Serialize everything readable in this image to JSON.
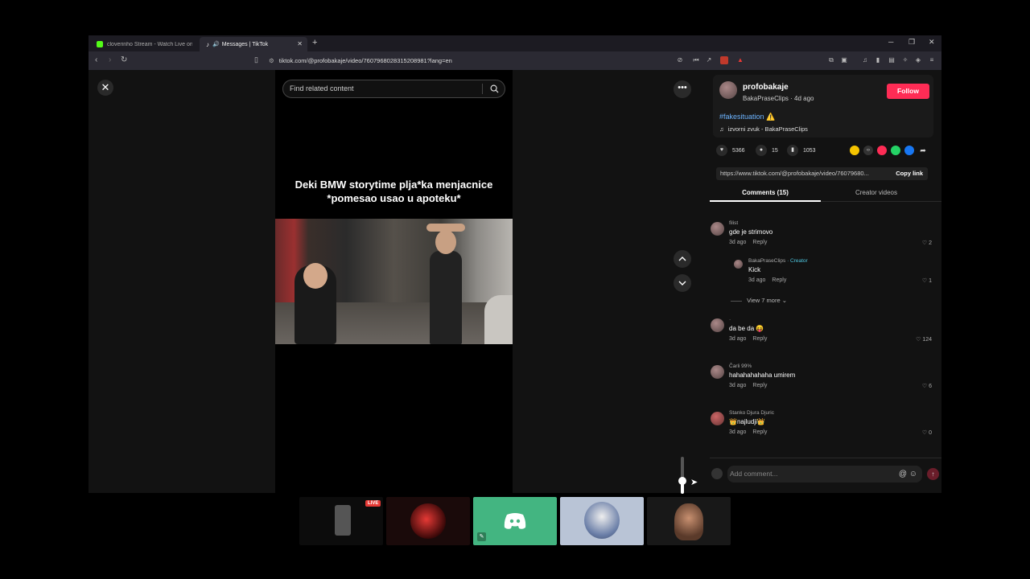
{
  "browser": {
    "tabs": [
      {
        "label": "cloverinho Stream - Watch Live on K",
        "favicon_color": "#53fc18"
      },
      {
        "label": "Messages | TikTok",
        "favicon_color": "#ffffff"
      }
    ],
    "url": "tiktok.com/@profobakaje/video/7607968028315208981?lang=en"
  },
  "video": {
    "search_placeholder": "Find related content",
    "caption_line1": "Deki BMW storytime plja*ka menjacnice",
    "caption_line2": "*pomesao usao u apoteku*",
    "volume_level": 0.35
  },
  "post": {
    "username": "profobakaje",
    "subline": "BakaPraseClips · 4d ago",
    "follow_label": "Follow",
    "hashtag": "#fakesituation ⚠️",
    "music": "izvorni zvuk - BakaPraseClips",
    "likes": "5366",
    "comments": "15",
    "saves": "1053",
    "link": "https://www.tiktok.com/@profobakaje/video/76079680...",
    "copy_label": "Copy link"
  },
  "tabs": {
    "comments": "Comments (15)",
    "creator_videos": "Creator videos"
  },
  "comments": [
    {
      "name": "filist",
      "text": "gde je strimovo",
      "time": "3d ago",
      "reply": "Reply",
      "likes": "2"
    },
    {
      "name": "BakaPraseClips",
      "badge": "· Creator",
      "text": "Kick",
      "time": "3d ago",
      "reply": "Reply",
      "likes": "1"
    },
    {
      "name": "·",
      "text": "da be da 😝",
      "time": "3d ago",
      "reply": "Reply",
      "likes": "124"
    },
    {
      "name": "Čarli 99%",
      "text": "hahahahahaha umirem",
      "time": "3d ago",
      "reply": "Reply",
      "likes": "6"
    },
    {
      "name": "Stanko Djura Djuric",
      "text": "👑najludji👑",
      "time": "3d ago",
      "reply": "Reply",
      "likes": "0"
    }
  ],
  "view_more": "View 7 more",
  "add_comment_placeholder": "Add comment...",
  "taskbar": {
    "live_label": "LIVE"
  },
  "colors": {
    "accent": "#fe2c55",
    "discord": "#43b581",
    "hashtag": "#6db4ff"
  }
}
